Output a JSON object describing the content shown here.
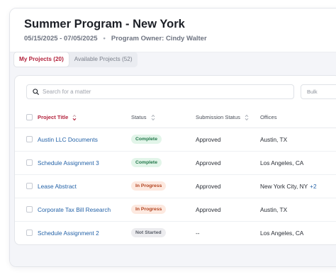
{
  "header": {
    "title": "Summer Program - New York",
    "date_range": "05/15/2025 - 07/05/2025",
    "separator": "•",
    "owner": "Program Owner: Cindy Walter"
  },
  "tabs": [
    {
      "label": "My Projects (20)",
      "active": true
    },
    {
      "label": "Available Projects (52)",
      "active": false
    }
  ],
  "search": {
    "placeholder": "Search for a matter",
    "value": ""
  },
  "bulk_label": "Bulk",
  "table": {
    "columns": [
      "Project Title",
      "Status",
      "Submission Status",
      "Offices"
    ],
    "rows": [
      {
        "title": "Austin LLC Documents",
        "status": "Complete",
        "submission": "Approved",
        "office": "Austin, TX",
        "more": ""
      },
      {
        "title": "Schedule Assignment 3",
        "status": "Complete",
        "submission": "Approved",
        "office": "Los Angeles, CA",
        "more": ""
      },
      {
        "title": "Lease Abstract",
        "status": "In Progress",
        "submission": "Approved",
        "office": "New York City, NY",
        "more": "+2"
      },
      {
        "title": "Corporate Tax Bill Research",
        "status": "In Progress",
        "submission": "Approved",
        "office": "Austin, TX",
        "more": ""
      },
      {
        "title": "Schedule Assignment 2",
        "status": "Not Started",
        "submission": "--",
        "office": "Los Angeles, CA",
        "more": ""
      }
    ]
  },
  "colors": {
    "accent": "#b3233d",
    "link": "#2563a8",
    "complete_bg": "#e2f5e9",
    "complete_fg": "#22774a",
    "progress_bg": "#fde9e0",
    "progress_fg": "#b2431f",
    "notstarted_bg": "#ececef",
    "notstarted_fg": "#5a5f69"
  },
  "icons": {
    "search": "search-icon",
    "sort": "sort-icon"
  }
}
